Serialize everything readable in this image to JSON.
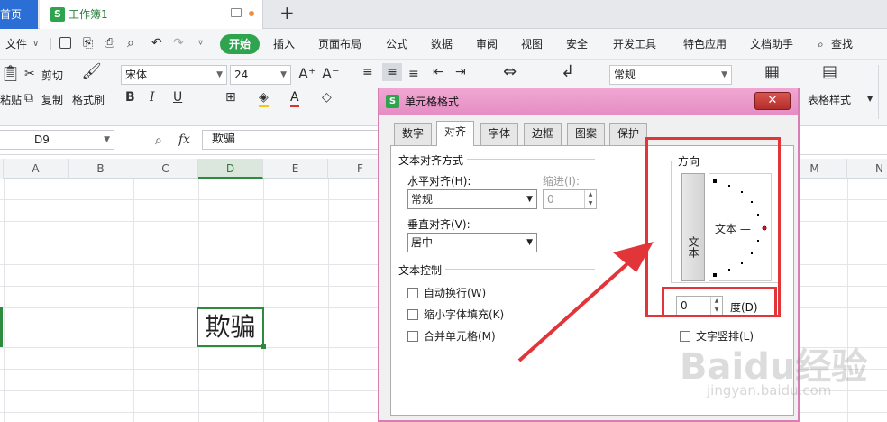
{
  "tabbar": {
    "home_tab": "首页",
    "doc_logo": "S",
    "doc_title": "工作簿1",
    "add_tab": "+"
  },
  "menubar": {
    "file": "文件",
    "items": [
      "开始",
      "插入",
      "页面布局",
      "公式",
      "数据",
      "审阅",
      "视图",
      "安全",
      "开发工具",
      "特色应用",
      "文档助手"
    ],
    "search": "查找"
  },
  "ribbon": {
    "cut": "剪切",
    "paste": "粘贴",
    "copy": "复制",
    "format_painter": "格式刷",
    "font_name": "宋体",
    "font_size": "24",
    "number_format": "常规",
    "table_style": "表格样式"
  },
  "formulabar": {
    "name_box": "D9",
    "fx": "fx",
    "value": "欺骗"
  },
  "columns": [
    "A",
    "B",
    "C",
    "D",
    "E",
    "F",
    "M",
    "N"
  ],
  "cell": {
    "value": "欺骗"
  },
  "dialog": {
    "logo": "S",
    "title": "单元格格式",
    "close": "✕",
    "tabs": [
      "数字",
      "对齐",
      "字体",
      "边框",
      "图案",
      "保护"
    ],
    "alignment_section": "文本对齐方式",
    "horizontal_label": "水平对齐(H):",
    "horizontal_value": "常规",
    "indent_label": "缩进(I):",
    "indent_value": "0",
    "vertical_label": "垂直对齐(V):",
    "vertical_value": "居中",
    "control_section": "文本控制",
    "wrap_text": "自动换行(W)",
    "shrink_to_fit": "缩小字体填充(K)",
    "merge_cells": "合并单元格(M)",
    "orientation_section": "方向",
    "vertical_text": "文本",
    "dial_text": "文本 —",
    "degree_value": "0",
    "degree_label": "度(D)",
    "vertical_arrange": "文字竖排(L)"
  },
  "watermark": {
    "brand": "Baidu经验",
    "url": "jingyan.baidu.com"
  },
  "colors": {
    "accent_green": "#2ea44f",
    "annotation_red": "#e2353a",
    "dialog_frame": "#e58cc3"
  }
}
